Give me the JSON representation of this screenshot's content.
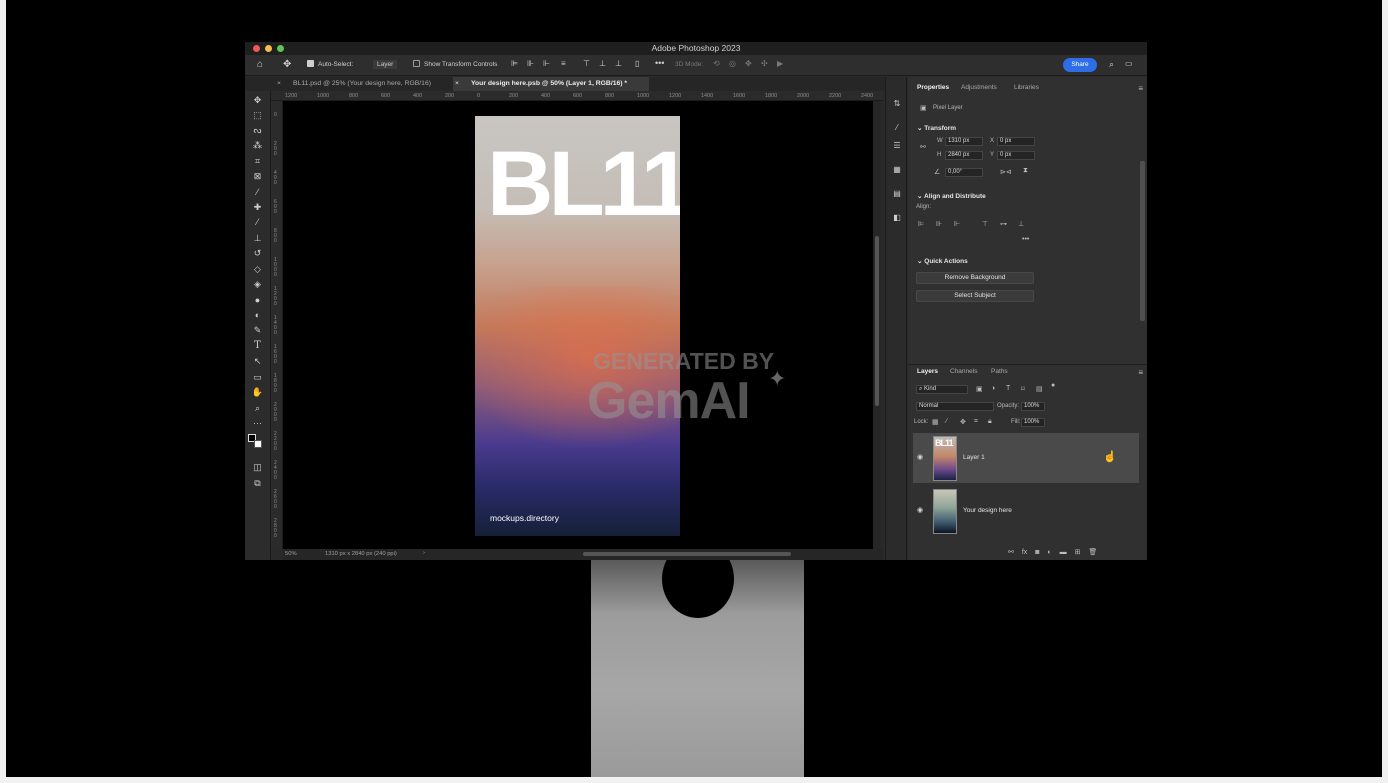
{
  "window": {
    "title": "Adobe Photoshop 2023",
    "traffic_colors": [
      "#ee5a52",
      "#f4bf4f",
      "#5fc554"
    ]
  },
  "optionsbar": {
    "auto_select_label": "Auto-Select:",
    "auto_select_value": "Layer",
    "show_transform_label": "Show Transform Controls",
    "mode_3d_label": "3D Mode:",
    "share_label": "Share",
    "accent_color": "#2f6de6"
  },
  "tabs": [
    {
      "label": "BL11.psd @ 25% (Your design here, RGB/16)"
    },
    {
      "label": "Your design here.psb @ 50% (Layer 1, RGB/16) *"
    }
  ],
  "ruler": {
    "top_labels": [
      "1200",
      "1000",
      "800",
      "600",
      "400",
      "200",
      "0",
      "200",
      "400",
      "600",
      "800",
      "1000",
      "1200",
      "1400",
      "1600",
      "1800",
      "2000",
      "2200",
      "2400"
    ],
    "left_labels": [
      "0",
      "200",
      "400",
      "600",
      "800",
      "1000",
      "1200",
      "1400",
      "1600",
      "1800",
      "2000",
      "2200",
      "2400",
      "2600",
      "2800"
    ]
  },
  "canvas": {
    "poster_title": "BL11",
    "poster_footer": "mockups.directory",
    "watermark_line1": "GENERATED BY",
    "watermark_line2": "GemAI"
  },
  "status": {
    "zoom": "50%",
    "doc_info": "1310 px x 2840 px (240 ppi)"
  },
  "properties": {
    "tabs": [
      "Properties",
      "Adjustments",
      "Libraries"
    ],
    "layer_type": "Pixel Layer",
    "transform_title": "Transform",
    "w_label": "W",
    "w_value": "1310 px",
    "h_label": "H",
    "h_value": "2840 px",
    "x_label": "X",
    "x_value": "0 px",
    "y_label": "Y",
    "y_value": "0 px",
    "angle_value": "0,00°",
    "align_title": "Align and Distribute",
    "align_label": "Align:",
    "quick_title": "Quick Actions",
    "remove_bg_label": "Remove Background",
    "select_subject_label": "Select Subject"
  },
  "layers": {
    "tabs": [
      "Layers",
      "Channels",
      "Paths"
    ],
    "kind_label": "Kind",
    "blend_mode": "Normal",
    "opacity_label": "Opacity:",
    "opacity_value": "100%",
    "lock_label": "Lock:",
    "fill_label": "Fill:",
    "fill_value": "100%",
    "items": [
      {
        "name": "Layer 1",
        "thumb_text": "BL11",
        "selected": true
      },
      {
        "name": "Your design here",
        "selected": false
      }
    ]
  }
}
